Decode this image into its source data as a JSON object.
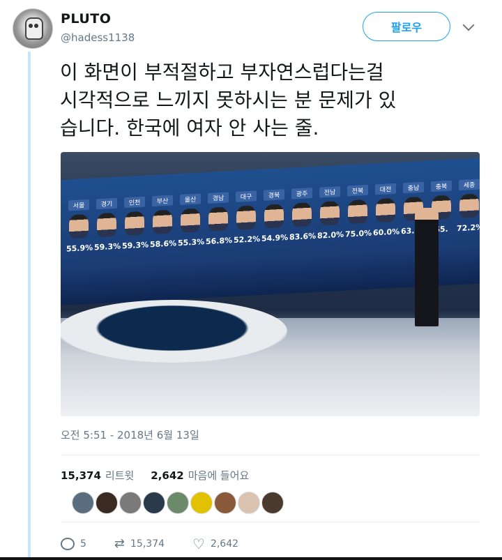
{
  "user": {
    "display_name": "PLUTO",
    "handle": "@hadess1138",
    "follow_label": "팔로우"
  },
  "tweet": {
    "text": "이 화면이 부적절하고 부자연스럽다는걸\n시각적으로 느끼지 못하시는 분 문제가 있\n습니다. 한국에 여자 안 사는 줄.",
    "timestamp": "오전 5:51 - 2018년 6월 13일"
  },
  "image": {
    "regions": [
      {
        "name": "서울",
        "pct": "55.9%"
      },
      {
        "name": "경기",
        "pct": "59.3%"
      },
      {
        "name": "인천",
        "pct": "59.3%"
      },
      {
        "name": "부산",
        "pct": "58.6%"
      },
      {
        "name": "울산",
        "pct": "55.3%"
      },
      {
        "name": "경남",
        "pct": "56.8%"
      },
      {
        "name": "대구",
        "pct": "52.2%"
      },
      {
        "name": "경북",
        "pct": "54.9%"
      },
      {
        "name": "광주",
        "pct": "83.6%"
      },
      {
        "name": "전남",
        "pct": "82.0%"
      },
      {
        "name": "전북",
        "pct": "75.0%"
      },
      {
        "name": "대전",
        "pct": "60.0%"
      },
      {
        "name": "충남",
        "pct": "63.7%"
      },
      {
        "name": "충북",
        "pct": "65."
      },
      {
        "name": "세종",
        "pct": "72.2%"
      }
    ]
  },
  "stats": {
    "retweets_count": "15,374",
    "retweets_label": "리트윗",
    "likes_count": "2,642",
    "likes_label": "마음에 들어요"
  },
  "likers": [
    "#5a6e80",
    "#3a2a22",
    "#7a7a7a",
    "#2b3a4a",
    "#6b8a6a",
    "#e2c200",
    "#8a5a3a",
    "#d9c2b0",
    "#4a3a30"
  ],
  "actions": {
    "reply_count": "5",
    "retweet_count": "15,374",
    "like_count": "2,642"
  }
}
